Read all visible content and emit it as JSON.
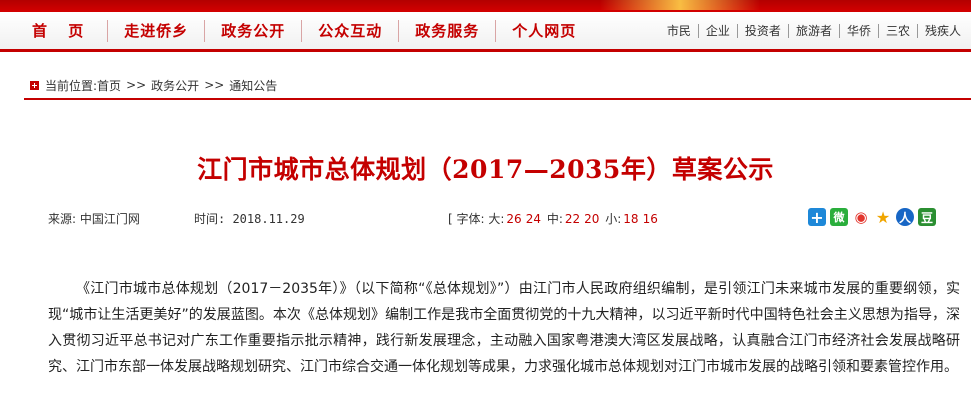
{
  "nav": {
    "main": [
      "首 页",
      "走进侨乡",
      "政务公开",
      "公众互动",
      "政务服务",
      "个人网页"
    ],
    "sub": [
      "市民",
      "企业",
      "投资者",
      "旅游者",
      "华侨",
      "三农",
      "残疾人"
    ]
  },
  "breadcrumb": {
    "label": "当前位置:",
    "items": [
      "首页",
      "政务公开",
      "通知公告"
    ],
    "separator": ">>"
  },
  "article": {
    "title": "江门市城市总体规划（2017—2035年）草案公示",
    "source": "来源: 中国江门网",
    "time": "时间: 2018.11.29",
    "font_label_open": "[ 字体:",
    "big_label": "大:",
    "big_sizes": [
      "26",
      "24"
    ],
    "mid_label": "中:",
    "mid_sizes": [
      "22",
      "20"
    ],
    "small_label": "小:",
    "small_sizes": [
      "18",
      "16"
    ],
    "share_icons": [
      "plus-icon",
      "wechat-icon",
      "weibo-icon",
      "star-icon",
      "renren-icon",
      "douban-icon"
    ],
    "share_glyphs": [
      "+",
      "微",
      "◉",
      "★",
      "人",
      "豆"
    ],
    "body": "《江门市城市总体规划（2017－2035年）》（以下简称“《总体规划》”）由江门市人民政府组织编制，是引领江门未来城市发展的重要纲领，实现“城市让生活更美好”的发展蓝图。本次《总体规划》编制工作是我市全面贯彻党的十九大精神，以习近平新时代中国特色社会主义思想为指导，深入贯彻习近平总书记对广东工作重要指示批示精神，践行新发展理念，主动融入国家粤港澳大湾区发展战略，认真融合江门市经济社会发展战略研究、江门市东部一体发展战略规划研究、江门市综合交通一体化规划等成果，力求强化城市总体规划对江门市城市发展的战略引领和要素管控作用。"
  },
  "colors": {
    "accent": "#c40000",
    "text": "#222222"
  }
}
